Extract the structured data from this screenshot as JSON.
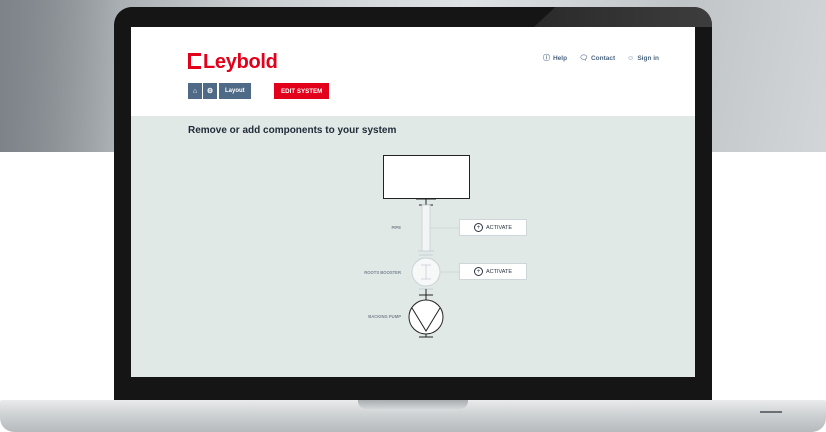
{
  "brand": {
    "name": "Leybold",
    "accent": "#e2001a",
    "nav_color": "#4f6a86"
  },
  "top_links": [
    {
      "icon": "help-icon",
      "label": "Help"
    },
    {
      "icon": "contact-icon",
      "label": "Contact"
    },
    {
      "icon": "user-icon",
      "label": "Sign in"
    }
  ],
  "breadcrumb": {
    "home_icon": "home-icon",
    "settings_icon": "gear-icon",
    "layout_label": "Layout"
  },
  "edit_button": "EDIT SYSTEM",
  "page_title": "Remove or add components to your system",
  "components": {
    "pipe": {
      "label": "PIPE",
      "action": "ACTIVATE"
    },
    "roots_booster": {
      "label": "ROOTS BOOSTER",
      "action": "ACTIVATE"
    },
    "backing_pump": {
      "label": "BACKING PUMP"
    }
  }
}
